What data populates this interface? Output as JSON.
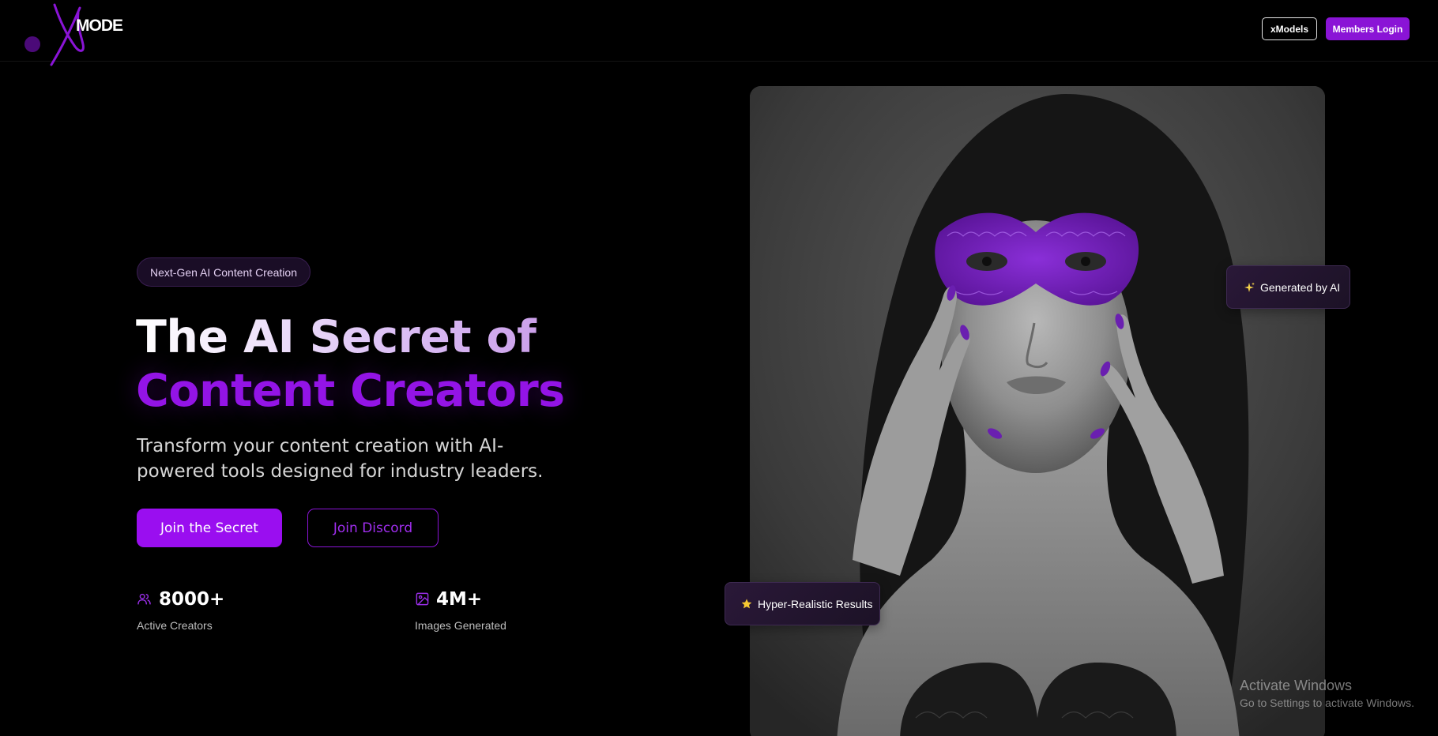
{
  "header": {
    "logo_text": "MODE",
    "nav": {
      "xmodels_label": "xModels",
      "login_label": "Members Login"
    }
  },
  "hero": {
    "badge": "Next-Gen AI Content Creation",
    "headline_line1": "The AI Secret of",
    "headline_line2": "Content Creators",
    "subtext": "Transform your content creation with AI-powered tools designed for industry leaders.",
    "cta_primary": "Join the Secret",
    "cta_secondary": "Join Discord",
    "stats": [
      {
        "icon": "users-icon",
        "value": "8000+",
        "label": "Active Creators"
      },
      {
        "icon": "image-icon",
        "value": "4M+",
        "label": "Images Generated"
      }
    ]
  },
  "hero_image": {
    "description_icon": "masked-portrait-image",
    "cards": {
      "generated": {
        "icon": "sparkles-icon",
        "label": "Generated by AI"
      },
      "realistic": {
        "icon": "star-icon",
        "label": "Hyper-Realistic Results"
      }
    }
  },
  "watermark": {
    "title": "Activate Windows",
    "subtitle": "Go to Settings to activate Windows."
  },
  "colors": {
    "accent": "#9a0ef0",
    "accent_dark": "#8a14d6",
    "background": "#000000",
    "mask_purple": "#6a1fb0"
  }
}
